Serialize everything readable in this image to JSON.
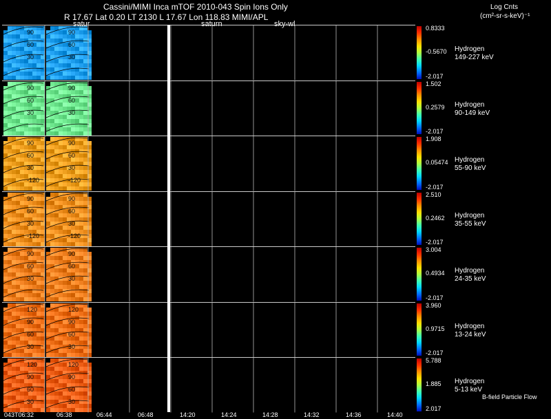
{
  "header": {
    "title": "Cassini/MIMI Inca mTOF  2010-043   Spin    Ions Only",
    "subtitle": "R       17.67 Lat 0.20 LT 2130 L         17.67 Lon          118.83  MIMI/APL",
    "units_line1": "Log Cnts",
    "units_line2": "(cm²-sr-s-keV)⁻¹",
    "pointing": [
      "satur",
      "saturn",
      "sky-wl"
    ]
  },
  "footer": {
    "x_labels": [
      "043T06:32",
      "06:38",
      "06:44",
      "06:48",
      "14:20",
      "14:24",
      "14:28",
      "14:32",
      "14:36",
      "14:40"
    ],
    "flow_label": "B-field Particle Flow"
  },
  "chart_data": {
    "type": "heatmap",
    "colorbar_colors": [
      "#c00000",
      "#ff9000",
      "#ffe000",
      "#40ffb0",
      "#0070ff",
      "#0010c0"
    ],
    "panels": [
      {
        "species": "Hydrogen",
        "energy": "149-227 keV",
        "max": "0.8333",
        "mid": "-0.5670",
        "min": "-2.017",
        "contours": [
          "90",
          "60",
          "30"
        ],
        "dominant": "#20a0f0"
      },
      {
        "species": "Hydrogen",
        "energy": "90-149 keV",
        "max": "1.502",
        "mid": "0.2579",
        "min": "-2.017",
        "contours": [
          "90",
          "60",
          "30"
        ],
        "dominant": "#70e890"
      },
      {
        "species": "Hydrogen",
        "energy": "55-90 keV",
        "max": "1.908",
        "mid": "0.05474",
        "min": "-2.017",
        "contours": [
          "90",
          "60",
          "30",
          "-120"
        ],
        "dominant": "#f0a020"
      },
      {
        "species": "Hydrogen",
        "energy": "35-55 keV",
        "max": "2.510",
        "mid": "0.2462",
        "min": "-2.017",
        "contours": [
          "90",
          "60",
          "30",
          "-120"
        ],
        "dominant": "#f09020"
      },
      {
        "species": "Hydrogen",
        "energy": "24-35 keV",
        "max": "3.004",
        "mid": "0.4934",
        "min": "-2.017",
        "contours": [
          "90",
          "60",
          "30"
        ],
        "dominant": "#f08020"
      },
      {
        "species": "Hydrogen",
        "energy": "13-24 keV",
        "max": "3.960",
        "mid": "0.9715",
        "min": "-2.017",
        "contours": [
          "120",
          "90",
          "60",
          "30"
        ],
        "dominant": "#f07018"
      },
      {
        "species": "Hydrogen",
        "energy": "5-13 keV",
        "max": "5.788",
        "mid": "1.885",
        "min": "2.017",
        "contours": [
          "120",
          "90",
          "60",
          "30"
        ],
        "dominant": "#f06018"
      }
    ]
  }
}
